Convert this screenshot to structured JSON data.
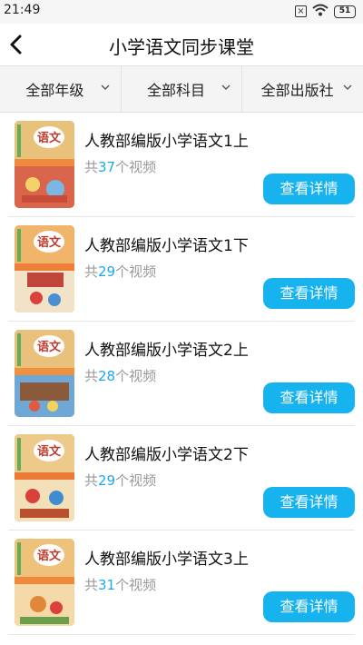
{
  "status_bar": {
    "time": "21:49",
    "sim_label": "×",
    "battery": "51"
  },
  "header": {
    "title": "小学语文同步课堂"
  },
  "filters": [
    {
      "label": "全部年级"
    },
    {
      "label": "全部科目"
    },
    {
      "label": "全部出版社"
    }
  ],
  "books": [
    {
      "title": "人教部编版小学语文1上",
      "count_prefix": "共",
      "count": "37",
      "count_suffix": "个视频",
      "button": "查看详情"
    },
    {
      "title": "人教部编版小学语文1下",
      "count_prefix": "共",
      "count": "29",
      "count_suffix": "个视频",
      "button": "查看详情"
    },
    {
      "title": "人教部编版小学语文2上",
      "count_prefix": "共",
      "count": "28",
      "count_suffix": "个视频",
      "button": "查看详情"
    },
    {
      "title": "人教部编版小学语文2下",
      "count_prefix": "共",
      "count": "29",
      "count_suffix": "个视频",
      "button": "查看详情"
    },
    {
      "title": "人教部编版小学语文3上",
      "count_prefix": "共",
      "count": "31",
      "count_suffix": "个视频",
      "button": "查看详情"
    }
  ],
  "cover": {
    "logo_text": "语文"
  },
  "colors": {
    "accent": "#16b3ef",
    "count_highlight": "#1ba9ee"
  }
}
